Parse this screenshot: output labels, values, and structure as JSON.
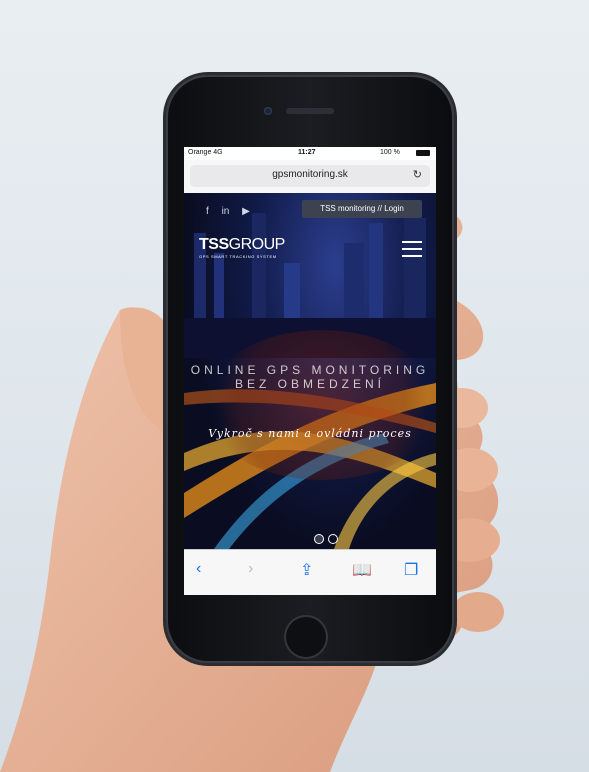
{
  "status_bar": {
    "carrier": "Orange 4G",
    "time": "11:27",
    "battery": "100 %"
  },
  "browser": {
    "url": "gpsmonitoring.sk"
  },
  "site": {
    "social": [
      "f",
      "in",
      "▶"
    ],
    "login_button": "TSS monitoring // Login",
    "logo": {
      "brand_bold": "TSS",
      "brand_light": "GROUP",
      "tagline": "GPS SMART TRACKING SYSTEM"
    },
    "headline": "ONLINE GPS MONITORING BEZ OBMEDZENÍ",
    "subheadline": "Vykroč s nami a ovládni proces"
  },
  "colors": {
    "accent": "#1a73e8",
    "login_bg": "#3c4250"
  }
}
